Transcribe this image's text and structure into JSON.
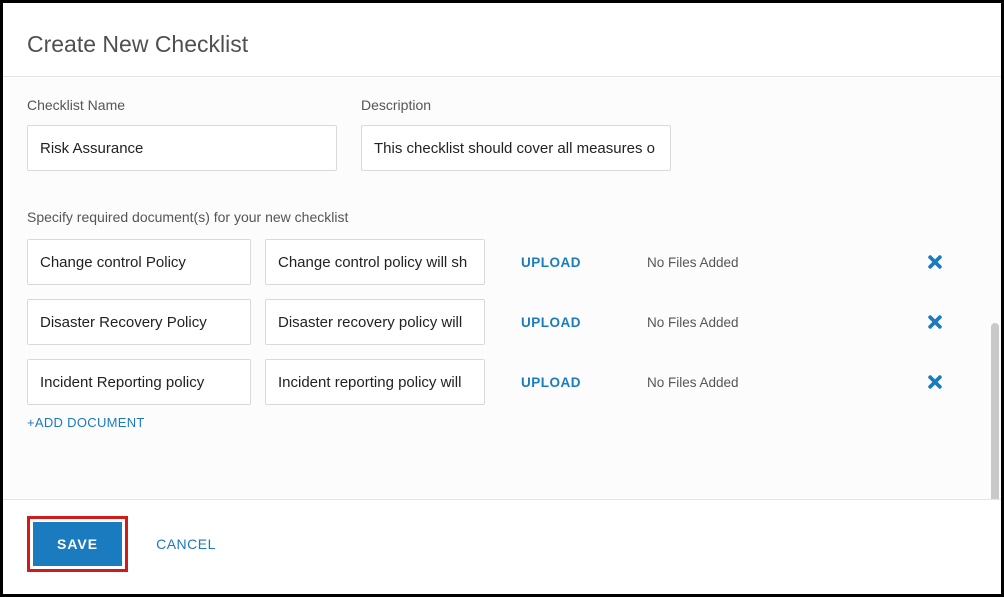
{
  "header": {
    "title": "Create New Checklist"
  },
  "form": {
    "name_label": "Checklist Name",
    "name_value": "Risk Assurance",
    "desc_label": "Description",
    "desc_value": "This checklist should cover all measures o"
  },
  "documents": {
    "section_label": "Specify required document(s) for your new checklist",
    "upload_label": "UPLOAD",
    "no_files_label": "No Files Added",
    "add_label": "+ADD DOCUMENT",
    "rows": [
      {
        "name": "Change control Policy",
        "desc": "Change control policy will sh"
      },
      {
        "name": "Disaster Recovery Policy",
        "desc": "Disaster recovery policy will"
      },
      {
        "name": "Incident Reporting policy",
        "desc": "Incident reporting policy will"
      }
    ]
  },
  "footer": {
    "save": "SAVE",
    "cancel": "CANCEL"
  }
}
